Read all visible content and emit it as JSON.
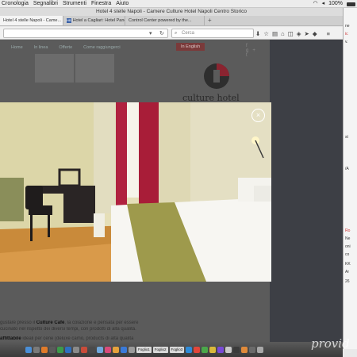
{
  "menubar": {
    "items": [
      "Cronologia",
      "Segnalibri",
      "Strumenti",
      "Finestra",
      "Aiuto"
    ],
    "battery": "100%"
  },
  "window": {
    "title": "Hotel 4 stelle Napoli - Camere Culture Hotel Napoli Centro Storico"
  },
  "tabs": [
    {
      "label": "Hotel 4 stelle Napoli - Came...",
      "active": true
    },
    {
      "label": "Hotel a Cagliari: Hotel Pano...",
      "icon": "HB"
    },
    {
      "label": "Control Center powered by the..."
    }
  ],
  "navbar": {
    "search_placeholder": "Cerca"
  },
  "site": {
    "nav": [
      "Home",
      "In linea",
      "Offerte",
      "Come raggiungerci"
    ],
    "lang_button": "In English",
    "logo_text": "culture hotel",
    "body_lines": [
      {
        "before": "gustare presso il ",
        "bold": "Culture Café",
        "after": ", la colazione e pensata per essere"
      },
      {
        "before": "cucinato ",
        "bold": "",
        "after": "nel rispetto dei diversi tempi, con prodotti di alta qualità."
      },
      {
        "before": "",
        "bold": "affittabile",
        "after": " ideali per cene (deluxe camo, products di alta qualita"
      }
    ]
  },
  "lightbox": {
    "image_alt": "Hotel room with bed, desk, chair and red curtains",
    "close_icon": "close-icon"
  },
  "right_desktop": {
    "lines": [
      "ne",
      "ic",
      "v.",
      "st",
      "/A",
      "Ro",
      "Ne",
      "oni",
      "co",
      "KK",
      "Ar",
      "26"
    ]
  },
  "dock": {
    "docs": [
      "Foglio1",
      "Foglio2",
      "Foglio3"
    ]
  },
  "watermark": "provid"
}
